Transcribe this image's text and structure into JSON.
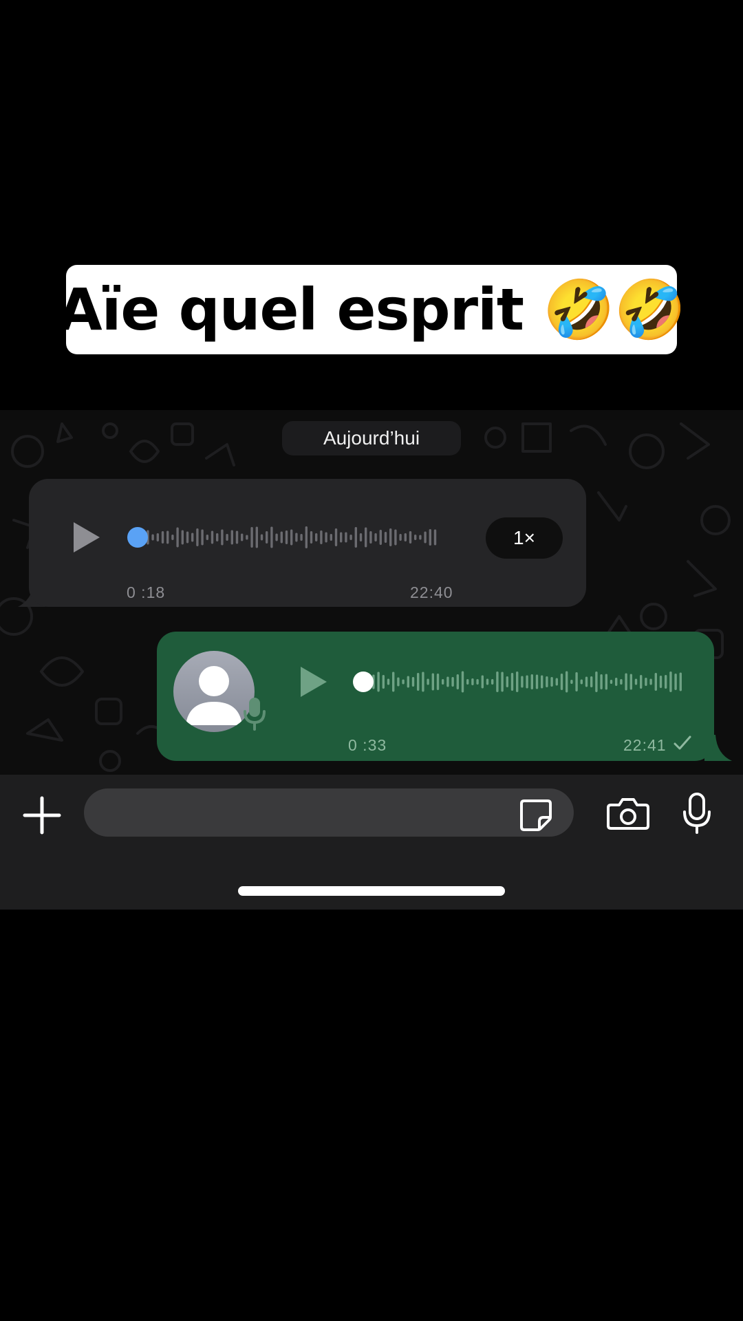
{
  "caption": {
    "text": "Aïe quel esprit 🤣🤣"
  },
  "chat": {
    "date_separator": "Aujourd’hui",
    "messages": [
      {
        "direction": "incoming",
        "kind": "voice",
        "duration": "0 :18",
        "time": "22:40",
        "speed": "1×",
        "progress_dot_color": "#5aa2f5"
      },
      {
        "direction": "outgoing",
        "kind": "voice",
        "duration": "0 :33",
        "time": "22:41",
        "status_icon": "check-icon",
        "progress_dot_color": "#ffffff"
      }
    ]
  },
  "input_bar": {
    "placeholder": "",
    "icons": [
      "plus-icon",
      "sticker-icon",
      "camera-icon",
      "microphone-icon"
    ]
  },
  "colors": {
    "incoming_bubble": "#252527",
    "outgoing_bubble": "#1f5c3b",
    "accent_blue": "#5aa2f5"
  }
}
